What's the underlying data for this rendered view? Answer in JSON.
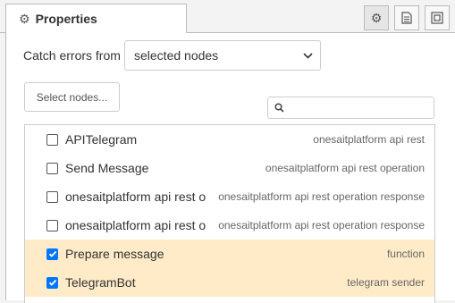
{
  "tab": {
    "title": "Properties",
    "icon": "gear-icon"
  },
  "toolbar": {
    "buttons": [
      {
        "icon": "gear-icon",
        "active": true
      },
      {
        "icon": "document-icon",
        "active": false
      },
      {
        "icon": "frame-icon",
        "active": false
      }
    ]
  },
  "catch": {
    "label": "Catch errors from",
    "selected": "selected nodes"
  },
  "select_nodes_label": "Select nodes...",
  "search": {
    "placeholder": ""
  },
  "nodes": [
    {
      "name": "APITelegram",
      "type": "onesaitplatform api rest",
      "checked": false
    },
    {
      "name": "Send Message",
      "type": "onesaitplatform api rest operation",
      "checked": false
    },
    {
      "name": "onesaitplatform api rest o",
      "type": "onesaitplatform api rest operation response",
      "checked": false
    },
    {
      "name": "onesaitplatform api rest o",
      "type": "onesaitplatform api rest operation response",
      "checked": false
    },
    {
      "name": "Prepare message",
      "type": "function",
      "checked": true
    },
    {
      "name": "TelegramBot",
      "type": "telegram sender",
      "checked": true
    }
  ],
  "colors": {
    "checked_row": "#ffebc7",
    "checkbox_on": "#0075ff"
  }
}
